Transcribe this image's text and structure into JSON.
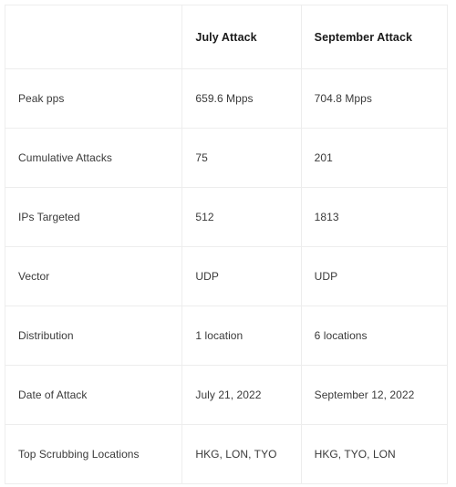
{
  "table": {
    "caption": "",
    "columns": [
      {
        "key": "label",
        "header": ""
      },
      {
        "key": "july",
        "header": "July Attack"
      },
      {
        "key": "september",
        "header": "September Attack"
      }
    ],
    "rows": [
      {
        "label": "Peak pps",
        "july": "659.6 Mpps",
        "september": "704.8 Mpps"
      },
      {
        "label": "Cumulative Attacks",
        "july": "75",
        "september": "201"
      },
      {
        "label": "IPs Targeted",
        "july": "512",
        "september": "1813"
      },
      {
        "label": "Vector",
        "july": "UDP",
        "september": "UDP"
      },
      {
        "label": "Distribution",
        "july": "1 location",
        "september": "6 locations"
      },
      {
        "label": "Date of Attack",
        "july": "July 21, 2022",
        "september": "September 12, 2022"
      },
      {
        "label": "Top Scrubbing Locations",
        "july": "HKG, LON, TYO",
        "september": "HKG, TYO, LON"
      }
    ]
  },
  "colors": {
    "background": "#ffffff",
    "border": "#ededed",
    "header_text": "#1a1a1a",
    "body_text": "#3a3a3a"
  }
}
